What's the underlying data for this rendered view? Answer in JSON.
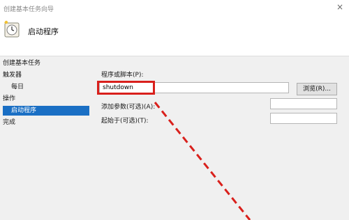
{
  "window": {
    "title": "创建基本任务向导",
    "close_glyph": "×"
  },
  "header": {
    "title": "启动程序",
    "icon": "task-scheduler-clock-icon"
  },
  "sidebar": {
    "items": [
      {
        "label": "创建基本任务"
      },
      {
        "label": "触发器"
      },
      {
        "label": "每日"
      },
      {
        "label": "操作"
      },
      {
        "label": "启动程序"
      },
      {
        "label": "完成"
      }
    ],
    "selected_index": 4
  },
  "form": {
    "program_label": "程序或脚本(P):",
    "program_value": "shutdown",
    "browse_label": "浏览(R)...",
    "args_label": "添加参数(可选)(A):",
    "args_value": "",
    "start_in_label": "起始于(可选)(T):",
    "start_in_value": ""
  },
  "annotation": {
    "highlight_color": "#d9201c",
    "arrow_style": "red-dashed-line"
  },
  "colors": {
    "selected_bg": "#1a6fc4",
    "background": "#f0f0f0"
  }
}
